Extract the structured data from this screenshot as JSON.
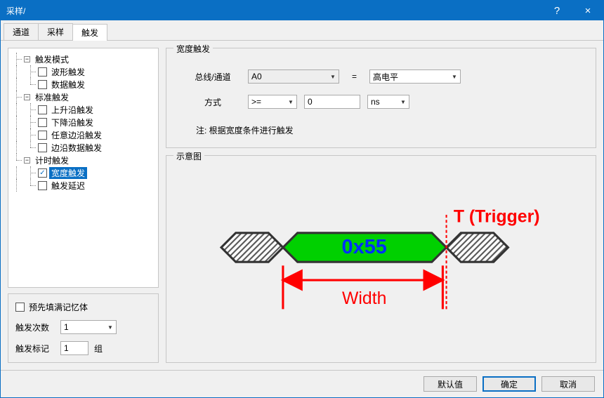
{
  "window": {
    "title": "采样/"
  },
  "titlebar_controls": {
    "help": "?",
    "close": "×"
  },
  "tabs": [
    {
      "label": "通道",
      "active": false
    },
    {
      "label": "采样",
      "active": false
    },
    {
      "label": "触发",
      "active": true
    }
  ],
  "tree": {
    "groups": [
      {
        "label": "触发模式",
        "items": [
          {
            "label": "波形触发",
            "checked": false
          },
          {
            "label": "数据触发",
            "checked": false
          }
        ]
      },
      {
        "label": "标准触发",
        "items": [
          {
            "label": "上升沿触发",
            "checked": false
          },
          {
            "label": "下降沿触发",
            "checked": false
          },
          {
            "label": "任意边沿触发",
            "checked": false
          },
          {
            "label": "边沿数据触发",
            "checked": false
          }
        ]
      },
      {
        "label": "计时触发",
        "items": [
          {
            "label": "宽度触发",
            "checked": true,
            "selected": true
          },
          {
            "label": "触发延迟",
            "checked": false
          }
        ]
      }
    ]
  },
  "left_bottom": {
    "prefill_label": "预先填满记忆体",
    "prefill_checked": false,
    "count_label": "触发次数",
    "count_value": "1",
    "mark_label": "触发标记",
    "mark_value": "1",
    "mark_unit": "组"
  },
  "width_trigger": {
    "legend": "宽度触发",
    "bus_label": "总线/通道",
    "bus_value": "A0",
    "equals": "=",
    "level_value": "高电平",
    "mode_label": "方式",
    "mode_value": ">=",
    "number_value": "0",
    "unit_value": "ns",
    "note": "注: 根据宽度条件进行触发"
  },
  "diagram": {
    "legend": "示意图",
    "trigger_text": "T (Trigger)",
    "data_text": "0x55",
    "width_text": "Width"
  },
  "footer": {
    "defaults": "默认值",
    "ok": "确定",
    "cancel": "取消"
  }
}
